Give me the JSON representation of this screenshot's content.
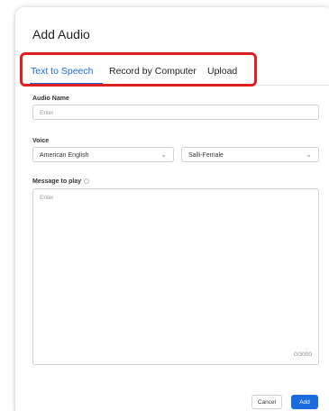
{
  "dialog": {
    "title": "Add Audio"
  },
  "tabs": [
    {
      "label": "Text to Speech",
      "active": true
    },
    {
      "label": "Record by Computer",
      "active": false
    },
    {
      "label": "Upload",
      "active": false
    }
  ],
  "form": {
    "audio_name": {
      "label": "Audio Name",
      "placeholder": "Enter",
      "value": ""
    },
    "voice": {
      "label": "Voice",
      "language": "American English",
      "voice_name": "Salli-Female"
    },
    "message": {
      "label": "Message to play",
      "placeholder": "Enter",
      "counter": "0/3000"
    }
  },
  "footer": {
    "cancel_label": "Cancel",
    "add_label": "Add"
  },
  "colors": {
    "accent": "#1a6be0",
    "highlight": "#e02020"
  },
  "icons": {
    "dropdown": "chevron-down-icon",
    "info": "info-icon"
  }
}
